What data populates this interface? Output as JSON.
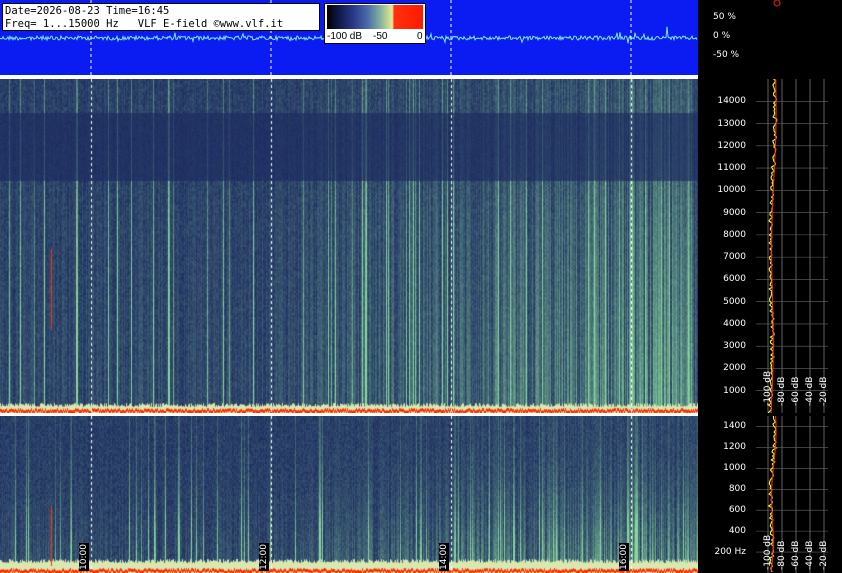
{
  "header": {
    "line1": "Date=2026-08-23 Time=16:45",
    "line2": "Freq= 1...15000 Hz   VLF E-field ©www.vlf.it"
  },
  "colorbar": {
    "labels": [
      "-100 dB",
      "-50",
      "0"
    ]
  },
  "waveform_axis": {
    "labels": [
      "50 %",
      "0 %",
      "-50 %"
    ]
  },
  "chart_data": [
    {
      "type": "heatmap",
      "title": "",
      "xlabel": "",
      "ylabel": "",
      "x_ticks": [
        "10:00",
        "12:00",
        "14:00",
        "16:00"
      ],
      "y_ticks": [
        "1000",
        "2000",
        "3000",
        "4000",
        "5000",
        "6000",
        "7000",
        "8000",
        "9000",
        "10000",
        "11000",
        "12000",
        "13000",
        "14000"
      ],
      "ylim": [
        0,
        15000
      ],
      "profile_ticks": [
        "-100 dB",
        "-80 dB",
        "-60 dB",
        "-40 dB",
        "-20 dB"
      ]
    },
    {
      "type": "heatmap",
      "title": "",
      "xlabel": "",
      "ylabel": "",
      "y_ticks": [
        "200 Hz",
        "400",
        "600",
        "800",
        "1000",
        "1200",
        "1400"
      ],
      "ylim": [
        0,
        1500
      ],
      "profile_ticks": [
        "-100 dB",
        "-80 dB",
        "-60 dB",
        "-40 dB",
        "-20 dB"
      ]
    }
  ],
  "colors": {
    "waveband": "#0a1cf2",
    "spectro_base": "#1c2a60",
    "spectro_hi": "#8fd0a0",
    "burst": "#ff2a00"
  }
}
